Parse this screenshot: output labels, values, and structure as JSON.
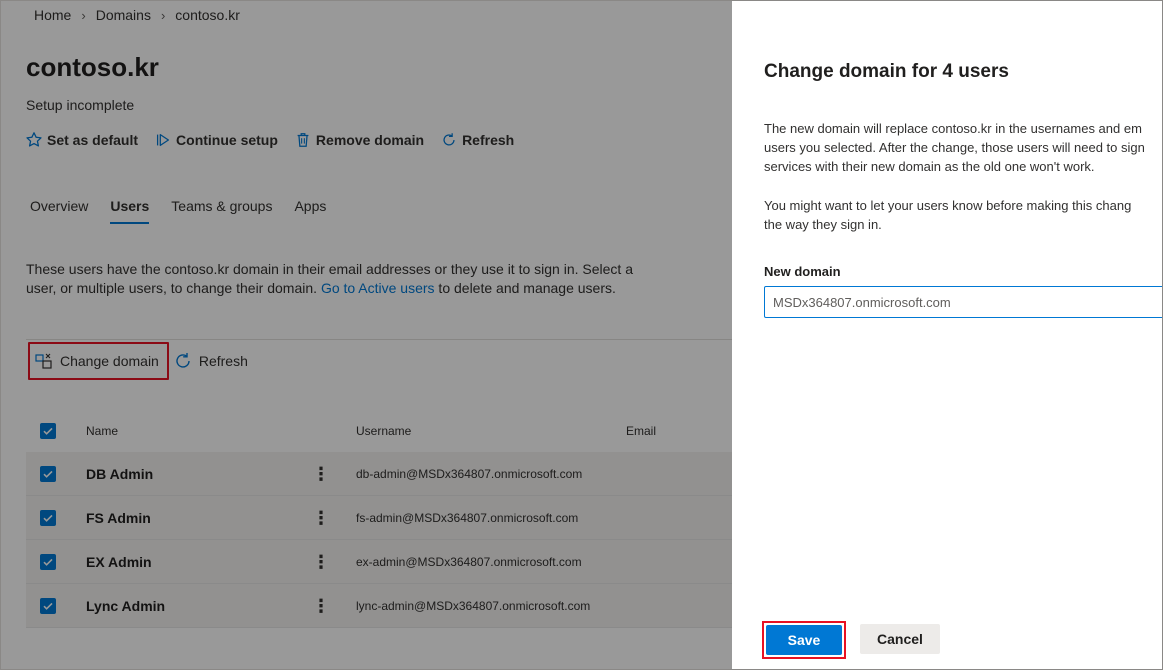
{
  "breadcrumb": {
    "home": "Home",
    "domains": "Domains",
    "current": "contoso.kr",
    "separator": ">"
  },
  "page": {
    "title": "contoso.kr",
    "subtitle": "Setup incomplete"
  },
  "commands": {
    "set_default": "Set as default",
    "continue_setup": "Continue setup",
    "remove_domain": "Remove domain",
    "refresh": "Refresh"
  },
  "tabs": [
    "Overview",
    "Users",
    "Teams & groups",
    "Apps"
  ],
  "active_tab": "Users",
  "description": {
    "text_before_link": "These users have the contoso.kr domain in their email addresses or they use it to sign in. Select a user, or multiple users, to change their domain. ",
    "link": "Go to Active users",
    "text_after_link": " to delete and manage users."
  },
  "toolbar": {
    "change_domain": "Change domain",
    "refresh": "Refresh"
  },
  "table": {
    "headers": {
      "name": "Name",
      "username": "Username",
      "email": "Email"
    },
    "rows": [
      {
        "name": "DB Admin",
        "username": "db-admin@MSDx364807.onmicrosoft.com",
        "email": "",
        "checked": true
      },
      {
        "name": "FS Admin",
        "username": "fs-admin@MSDx364807.onmicrosoft.com",
        "email": "",
        "checked": true
      },
      {
        "name": "EX Admin",
        "username": "ex-admin@MSDx364807.onmicrosoft.com",
        "email": "",
        "checked": true
      },
      {
        "name": "Lync Admin",
        "username": "lync-admin@MSDx364807.onmicrosoft.com",
        "email": "",
        "checked": true
      }
    ]
  },
  "panel": {
    "title": "Change domain for 4 users",
    "para1": [
      "The new domain will replace contoso.kr in the usernames and em",
      "users you selected. After the change, those users will need to sign",
      "services with their new domain as the old one won't work."
    ],
    "para2": [
      "You might want to let your users know before making this chang",
      "the way they sign in."
    ],
    "field_label": "New domain",
    "field_value": "MSDx364807.onmicrosoft.com",
    "save": "Save",
    "cancel": "Cancel"
  },
  "colors": {
    "accent": "#0078d4",
    "highlight": "#e81123",
    "overlay": "rgba(0,0,0,0.40)"
  }
}
